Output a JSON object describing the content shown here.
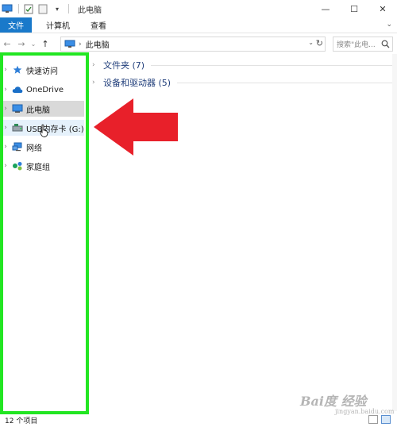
{
  "window": {
    "title": "此电脑",
    "controls": {
      "minimize": "—",
      "maximize": "☐",
      "close": "✕"
    }
  },
  "ribbon": {
    "tabs": [
      {
        "label": "文件",
        "active": true
      },
      {
        "label": "计算机"
      },
      {
        "label": "查看"
      }
    ],
    "expand_glyph": "⌄"
  },
  "nav": {
    "back": "←",
    "forward": "→",
    "recent": "⌄",
    "up": "↑"
  },
  "address": {
    "crumbs": [
      "此电脑"
    ],
    "dropdown": "⌄",
    "refresh": "↻"
  },
  "search": {
    "placeholder": "搜索\"此电..."
  },
  "sidebar": {
    "items": [
      {
        "label": "快速访问",
        "icon": "star-icon"
      },
      {
        "label": "OneDrive",
        "icon": "cloud-icon"
      },
      {
        "label": "此电脑",
        "icon": "computer-icon",
        "state": "selected"
      },
      {
        "label": "USB内存卡 (G:)",
        "icon": "usb-drive-icon",
        "state": "hover"
      },
      {
        "label": "网络",
        "icon": "network-icon"
      },
      {
        "label": "家庭组",
        "icon": "homegroup-icon"
      }
    ],
    "expander": "›"
  },
  "content": {
    "groups": [
      {
        "label": "文件夹 (7)"
      },
      {
        "label": "设备和驱动器 (5)"
      }
    ],
    "chevron": "›"
  },
  "status": {
    "count": "12 个项目"
  },
  "watermark": {
    "line1": "Bai度 经验",
    "line2": "jingyan.baidu.com"
  },
  "colors": {
    "accent": "#1979ca",
    "highlight_box": "#22e622",
    "arrow": "#e8202a",
    "selected_bg": "#d9d9d9",
    "hover_bg": "#e5f1fb"
  }
}
